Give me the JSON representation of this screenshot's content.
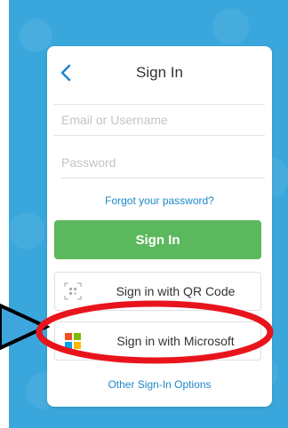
{
  "signin": {
    "title": "Sign In",
    "email_placeholder": "Email or Username",
    "password_placeholder": "Password",
    "forgot_link": "Forgot your password?",
    "signin_button": "Sign In",
    "qr_button": "Sign in with QR Code",
    "microsoft_button": "Sign in with Microsoft",
    "other_options": "Other Sign-In Options"
  },
  "colors": {
    "background": "#3aa7dc",
    "primary_button": "#5cb85c",
    "link": "#1e88c8",
    "highlight": "#e8141c",
    "arrow_fill": "#3ea6de"
  },
  "icons": {
    "back": "chevron-left-icon",
    "qr": "qr-code-icon",
    "microsoft": "microsoft-logo-icon"
  }
}
